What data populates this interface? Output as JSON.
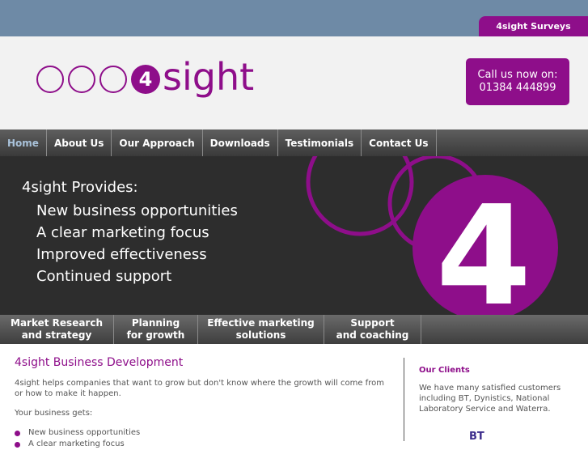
{
  "brand": {
    "purple": "#8e0e8a",
    "topbar": "#6e8aa6",
    "dark": "#2d2d2d"
  },
  "top_tab": {
    "label": "4sight Surveys"
  },
  "logo": {
    "digit": "4",
    "word": "sight"
  },
  "call_box": {
    "line1": "Call us now on:",
    "line2": "01384 444899"
  },
  "nav": {
    "items": [
      {
        "label": "Home"
      },
      {
        "label": "About Us"
      },
      {
        "label": "Our Approach"
      },
      {
        "label": "Downloads"
      },
      {
        "label": "Testimonials"
      },
      {
        "label": "Contact Us"
      }
    ]
  },
  "banner": {
    "heading": "4sight Provides:",
    "points": [
      "New business opportunities",
      "A clear marketing focus",
      "Improved effectiveness",
      "Continued support"
    ],
    "graphic_digit": "4"
  },
  "subnav": {
    "items": [
      {
        "line1": "Market Research",
        "line2": "and strategy"
      },
      {
        "line1": "Planning",
        "line2": "for growth"
      },
      {
        "line1": "Effective marketing",
        "line2": "solutions"
      },
      {
        "line1": "Support",
        "line2": "and coaching"
      }
    ]
  },
  "main": {
    "title": "4sight Business Development",
    "intro": "4sight helps companies that want to grow but don't know where the growth will come from or how to make it happen.",
    "gets_label": "Your business gets:",
    "bullets": [
      "New business opportunities",
      "A clear marketing focus"
    ]
  },
  "sidebar": {
    "title": "Our Clients",
    "text": "We have many satisfied customers including BT, Dynistics, National Laboratory Service and Waterra.",
    "client_logo": "BT"
  }
}
